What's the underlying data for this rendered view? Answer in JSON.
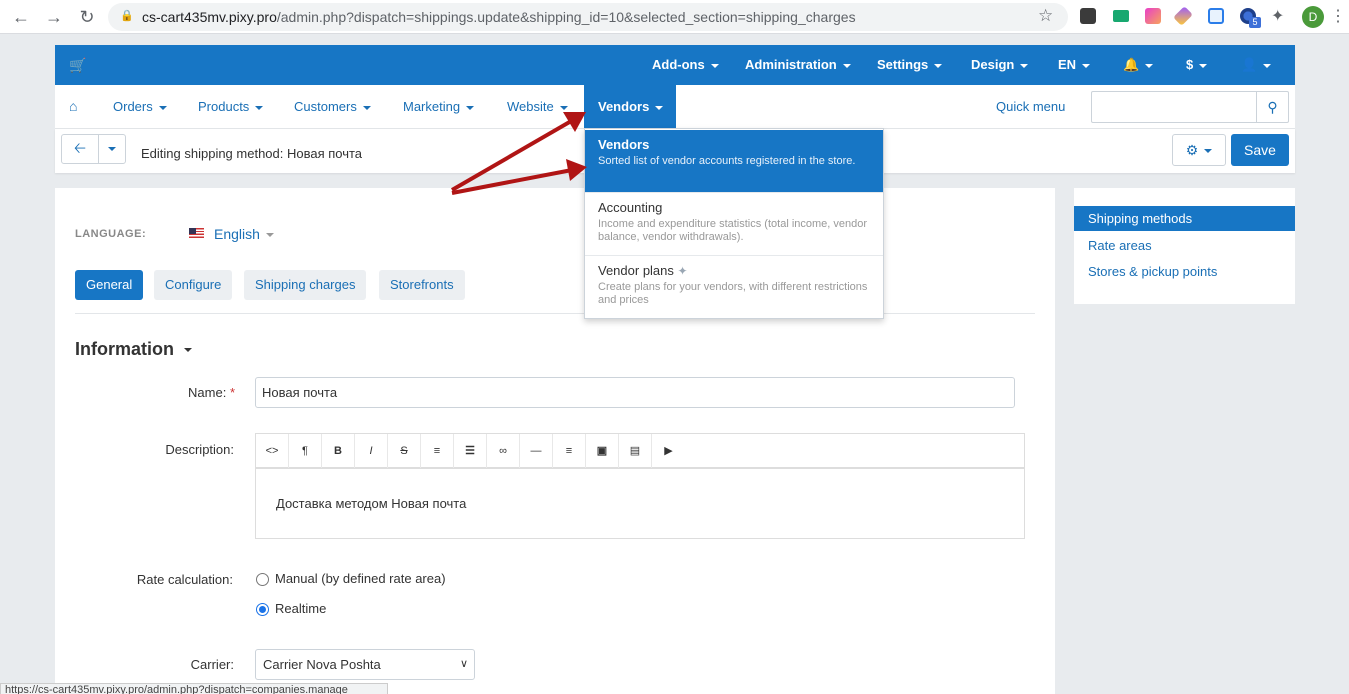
{
  "browser": {
    "url_host": "cs-cart435mv.pixy.pro",
    "url_rest": "/admin.php?dispatch=shippings.update&shipping_id=10&selected_section=shipping_charges",
    "profile_initial": "D",
    "extension_badge": "5",
    "status_url": "https://cs-cart435mv.pixy.pro/admin.php?dispatch=companies.manage"
  },
  "topbar": {
    "addons": "Add-ons",
    "administration": "Administration",
    "settings": "Settings",
    "design": "Design",
    "language": "EN",
    "currency": "$"
  },
  "nav": {
    "orders": "Orders",
    "products": "Products",
    "customers": "Customers",
    "marketing": "Marketing",
    "website": "Website",
    "vendors": "Vendors",
    "quick_menu": "Quick menu",
    "search_placeholder": ""
  },
  "toolbar": {
    "title": "Editing shipping method: Новая почта",
    "save_label": "Save"
  },
  "vendors_menu": [
    {
      "title": "Vendors",
      "desc": "Sorted list of vendor accounts registered in the store."
    },
    {
      "title": "Accounting",
      "desc": "Income and expenditure statistics (total income, vendor balance, vendor withdrawals)."
    },
    {
      "title": "Vendor plans",
      "desc": "Create plans for your vendors, with different restrictions and prices"
    }
  ],
  "form": {
    "language_label": "LANGUAGE:",
    "language_value": "English",
    "tabs": [
      "General",
      "Configure",
      "Shipping charges",
      "Storefronts"
    ],
    "section_heading": "Information",
    "name_label": "Name:",
    "required_mark": "*",
    "name_value": "Новая почта",
    "description_label": "Description:",
    "description_text": "Доставка методом Новая почта",
    "rate_calc_label": "Rate calculation:",
    "rate_option_manual": "Manual (by defined rate area)",
    "rate_option_realtime": "Realtime",
    "carrier_label": "Carrier:",
    "carrier_value": "Carrier Nova Poshta"
  },
  "editor_buttons": [
    "code-icon",
    "paragraph-icon",
    "bold-icon",
    "italic-icon",
    "strikethrough-icon",
    "bullet-list-icon",
    "numbered-list-icon",
    "link-icon",
    "horizontal-rule-icon",
    "align-icon",
    "font-color-icon",
    "image-icon",
    "video-icon"
  ],
  "sidebar": {
    "items": [
      "Shipping methods",
      "Rate areas",
      "Stores & pickup points"
    ]
  },
  "colors": {
    "brand_blue": "#1776c5",
    "link_blue": "#1a6fb5",
    "annotation_red": "#b01515"
  }
}
